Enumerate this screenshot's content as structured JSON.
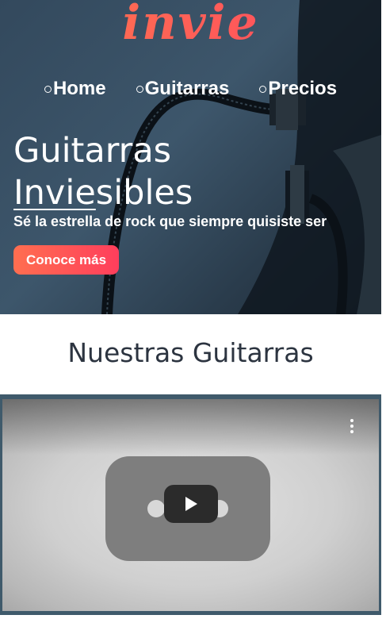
{
  "brand": {
    "logo_text": "invie"
  },
  "nav": {
    "items": [
      {
        "label": "Home"
      },
      {
        "label": "Guitarras"
      },
      {
        "label": "Precios"
      }
    ]
  },
  "hero": {
    "title_line1": "Guitarras",
    "title_line2_underlined": "Invie",
    "title_line2_rest": "sibles",
    "subtitle": "Sé la estrella de rock que siempre quisiste ser",
    "cta_label": "Conoce más"
  },
  "section": {
    "title": "Nuestras Guitarras"
  },
  "video": {
    "state": "paused",
    "icon": "play-icon"
  },
  "colors": {
    "accent_start": "#ff7a4e",
    "accent_end": "#ff4560",
    "hero_bg": "#3d566b",
    "video_frame": "#3f5a6b",
    "heading_text": "#2c3440"
  }
}
